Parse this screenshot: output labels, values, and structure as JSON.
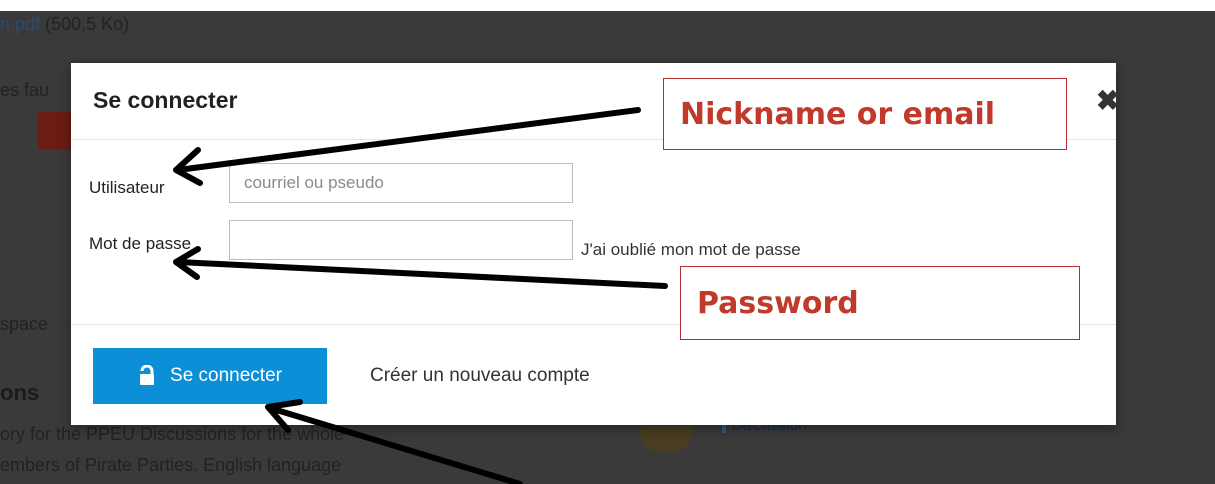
{
  "background": {
    "file_link": "n.pdf",
    "file_size": "(500,5 Ko)",
    "fragment_fau": "es fau",
    "fragment_space": "space",
    "fragment_ons": "ons",
    "fragment_line1": "ory for the PPEU Discussions for the whole",
    "fragment_line2": "embers of Pirate Parties. English language",
    "discussion_label": "Discussion"
  },
  "modal": {
    "title": "Se connecter",
    "close_symbol": "✖",
    "username_label": "Utilisateur",
    "username_placeholder": "courriel ou pseudo",
    "username_value": "",
    "password_label": "Mot de passe",
    "password_value": "",
    "forgot_link": "J'ai oublié mon mot de passe",
    "login_button": "Se connecter",
    "login_icon": "unlock-icon",
    "create_account_link": "Créer un nouveau compte",
    "accent_color": "#0d8fd8"
  },
  "annotations": {
    "nickname_label": "Nickname or email",
    "password_label": "Password",
    "color": "#c0392b"
  }
}
